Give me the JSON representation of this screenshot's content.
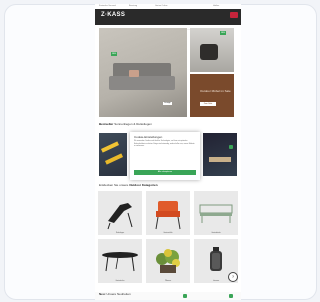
{
  "store": {
    "logo": "Z·KASS",
    "topbar": [
      "Kostenlos Versand",
      "Beratung",
      "Garten Online",
      "Hotline"
    ],
    "nav": [
      "Gartenmöbel",
      "Lounge",
      "Sonnenschutz",
      "Deko",
      "Outdoor",
      "Sale"
    ]
  },
  "hero": {
    "main_badge": "NEU",
    "main_label": "Lounge",
    "right_top_badge": "NEU",
    "right_bottom_text": "Outdoor Möbel im Sale",
    "right_bottom_button": "Zum Sale"
  },
  "sections": {
    "bestseller_title": "Bestseller",
    "bestseller_sub": "Sonnenliegen & Relaxliegen",
    "categories_title": "Entdecken Sie unsere",
    "categories_bold": "Outdoor Kategorien",
    "bottom_title": "Neu:",
    "bottom_bold": "Unsere Neuheiten"
  },
  "consent": {
    "title": "Cookie-Einstellungen",
    "text": "Wir verwenden Cookies und ähnliche Technologien, um Ihnen ein optimales Einkaufserlebnis zu bieten. Einige sind notwendig, andere helfen uns, unsere Website zu verbessern.",
    "accept_button": "Alle akzeptieren"
  },
  "categories": [
    {
      "name": "Relaxliegen"
    },
    {
      "name": "Gartenstühle"
    },
    {
      "name": "Gartenbänke"
    },
    {
      "name": "Gartentische"
    },
    {
      "name": "Pflanzen"
    },
    {
      "name": "Laternen"
    }
  ],
  "help_icon": "?",
  "colors": {
    "header": "#2a2a2a",
    "accent_green": "#3aa557",
    "sale_brown": "#7a4a2c",
    "cart_red": "#c6243b"
  }
}
